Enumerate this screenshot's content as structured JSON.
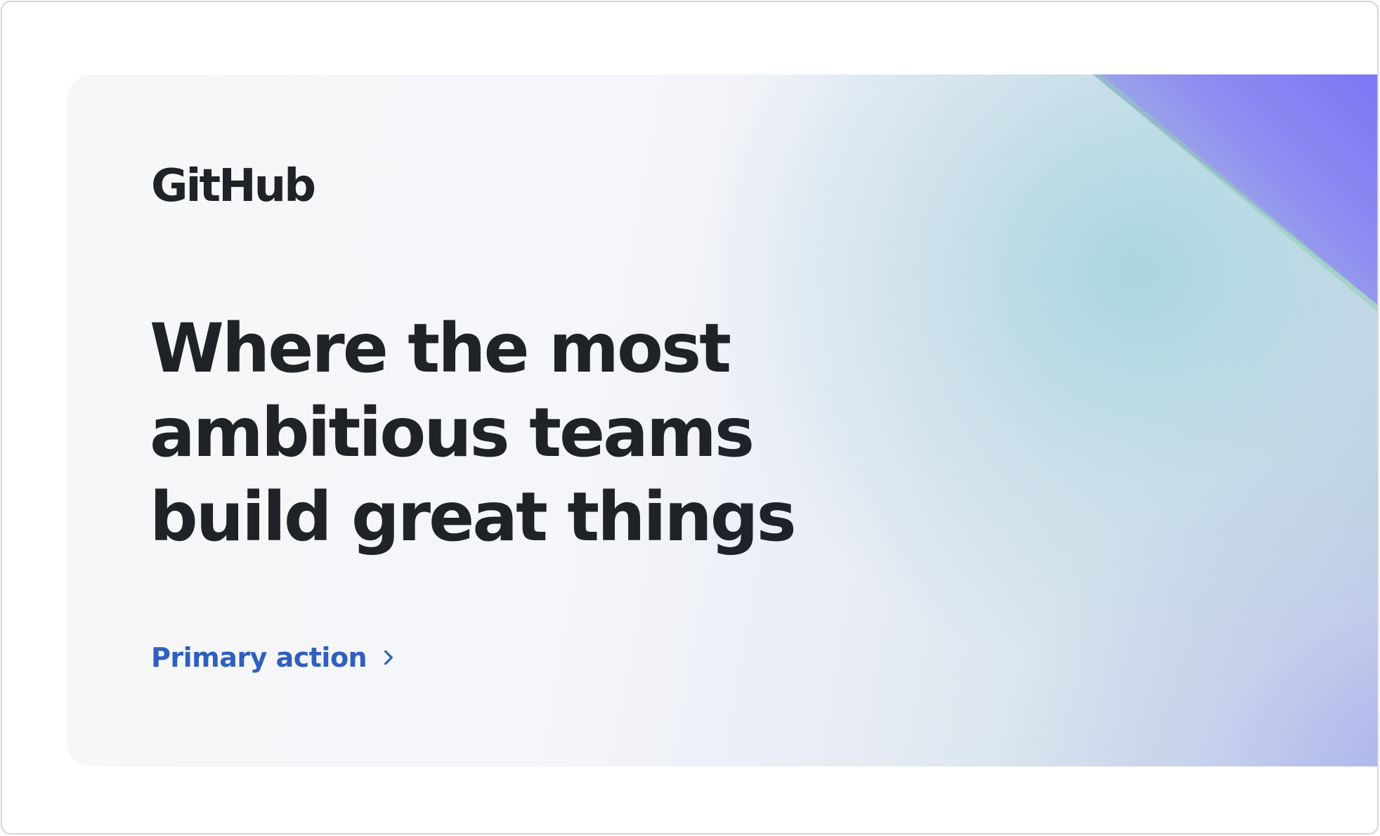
{
  "hero": {
    "logo_text": "GitHub",
    "headline": "Where the most ambitious teams build great things",
    "primary_action_label": "Primary action",
    "chevron_icon": "chevron-right-icon"
  },
  "colors": {
    "text": "#1f2328",
    "link": "#2f5fbf",
    "accent_purple": "#7a75f7",
    "accent_teal": "#a8d6de"
  }
}
